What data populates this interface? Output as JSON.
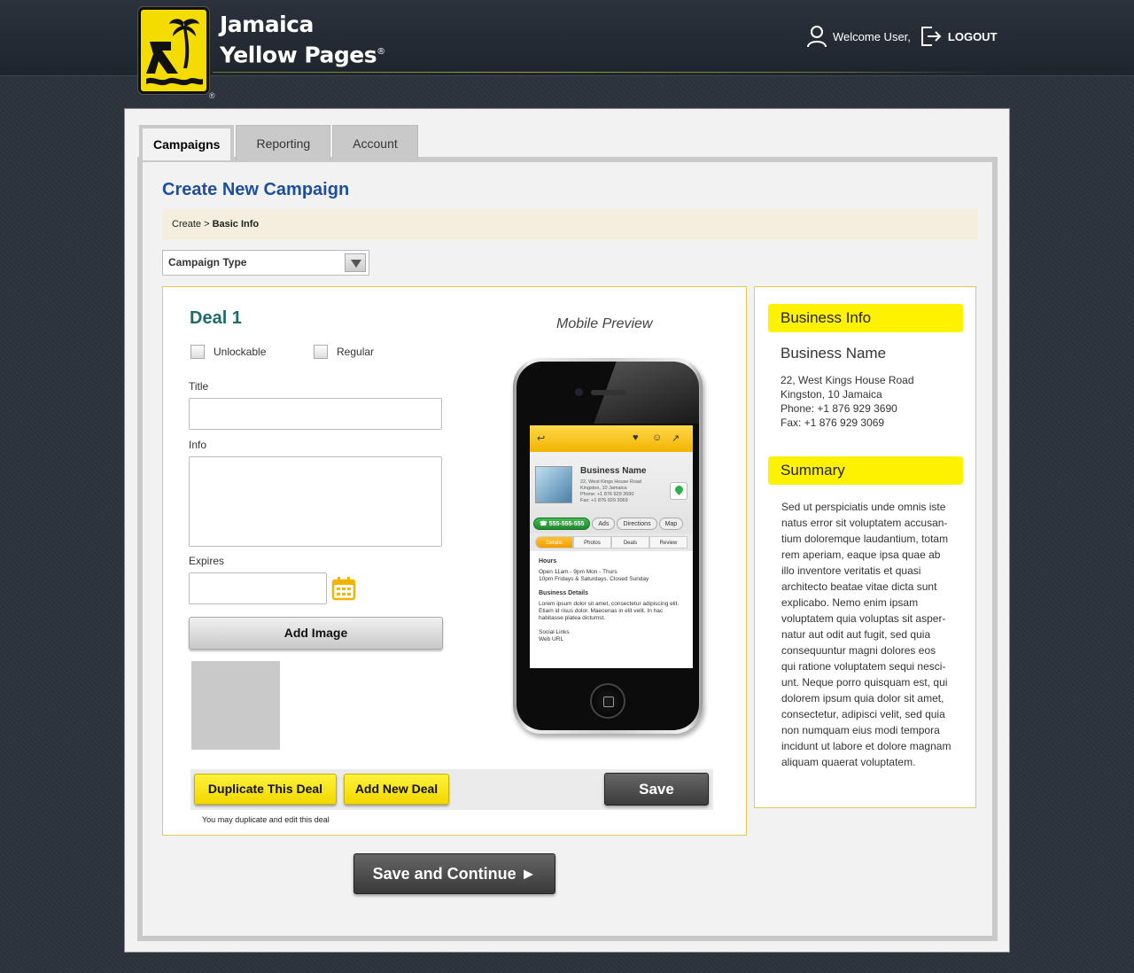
{
  "brand": {
    "line1": "Jamaica",
    "line2": "Yellow Pages",
    "reg_mark": "®",
    "logo_reg_mark": "®"
  },
  "user": {
    "welcome": "Welcome User,",
    "logout": "LOGOUT"
  },
  "tabs": [
    {
      "label": "Campaigns",
      "active": true
    },
    {
      "label": "Reporting",
      "active": false
    },
    {
      "label": "Account",
      "active": false
    }
  ],
  "page": {
    "title": "Create New Campaign",
    "breadcrumb_prefix": "Create >",
    "breadcrumb_current": "Basic Info"
  },
  "campaign_type": {
    "selected": "Campaign Type"
  },
  "deal": {
    "title": "Deal 1",
    "checkbox_unlockable": "Unlockable",
    "checkbox_regular": "Regular",
    "title_label": "Title",
    "title_value": "",
    "info_label": "Info",
    "info_value": "",
    "expires_label": "Expires",
    "expires_value": "",
    "add_image": "Add Image",
    "duplicate": "Duplicate This Deal",
    "add_new": "Add New Deal",
    "save": "Save",
    "note": "You may duplicate and edit this deal"
  },
  "mobile_preview": {
    "label": "Mobile Preview",
    "business_name": "Business Name",
    "address_lines": [
      "22, West Kings House Road",
      "Kingston, 10 Jamaica",
      "Phone: +1 876 929 3690",
      "Fax: +1 876 929 3069"
    ],
    "phone_chip": "555-555-555",
    "chips": [
      "Ads",
      "Directions",
      "Map"
    ],
    "subtabs": [
      "Details",
      "Photos",
      "Deals",
      "Review"
    ],
    "hours_title": "Hours",
    "hours_lines": [
      "Open 11am - 9pm Mon - Thurs",
      "10pm Fridays & Saturdays. Closed Sunday"
    ],
    "details_title": "Business Details",
    "details_text": "Lorem ipsum dolor sit amet, consectetur adipiscing elit. Etiam id risus dolor. Maecenas in elit velit. In hac habitasse platea dictumst.",
    "social_links": "Social Links",
    "web_url": "Web URL"
  },
  "business_info": {
    "heading": "Business Info",
    "name": "Business Name",
    "address1": "22, West Kings House Road",
    "address2": "Kingston, 10 Jamaica",
    "phone": "Phone: +1 876 929 3690",
    "fax": "Fax: +1 876 929 3069"
  },
  "summary": {
    "heading": "Summary",
    "text": "Sed ut perspiciatis unde omnis iste natus error sit voluptatem accusan-tium doloremque laudantium, totam rem aperiam, eaque ipsa quae ab illo inventore veritatis et quasi architecto beatae vitae dicta sunt explicabo. Nemo enim ipsam voluptatem quia voluptas sit asper-natur aut odit aut fugit, sed quia consequuntur magni dolores eos qui ratione voluptatem sequi nesci-unt. Neque porro quisquam est, qui dolorem ipsum quia dolor sit amet, consectetur, adipisci velit, sed quia non numquam eius modi tempora incidunt ut labore et dolore magnam aliquam quaerat voluptatem."
  },
  "footer": {
    "save_continue": "Save and Continue ►"
  },
  "colors": {
    "brand_yellow": "#fff200",
    "title_blue": "#1d4f9c",
    "deal_teal": "#1f6b6b",
    "header_bg": "#2b323c"
  },
  "icons": [
    "user-icon",
    "logout-icon",
    "calendar-icon",
    "dropdown-arrow-icon",
    "back-arrow-icon",
    "heart-icon",
    "person-icon",
    "share-icon",
    "map-pin-icon",
    "phone-icon"
  ]
}
